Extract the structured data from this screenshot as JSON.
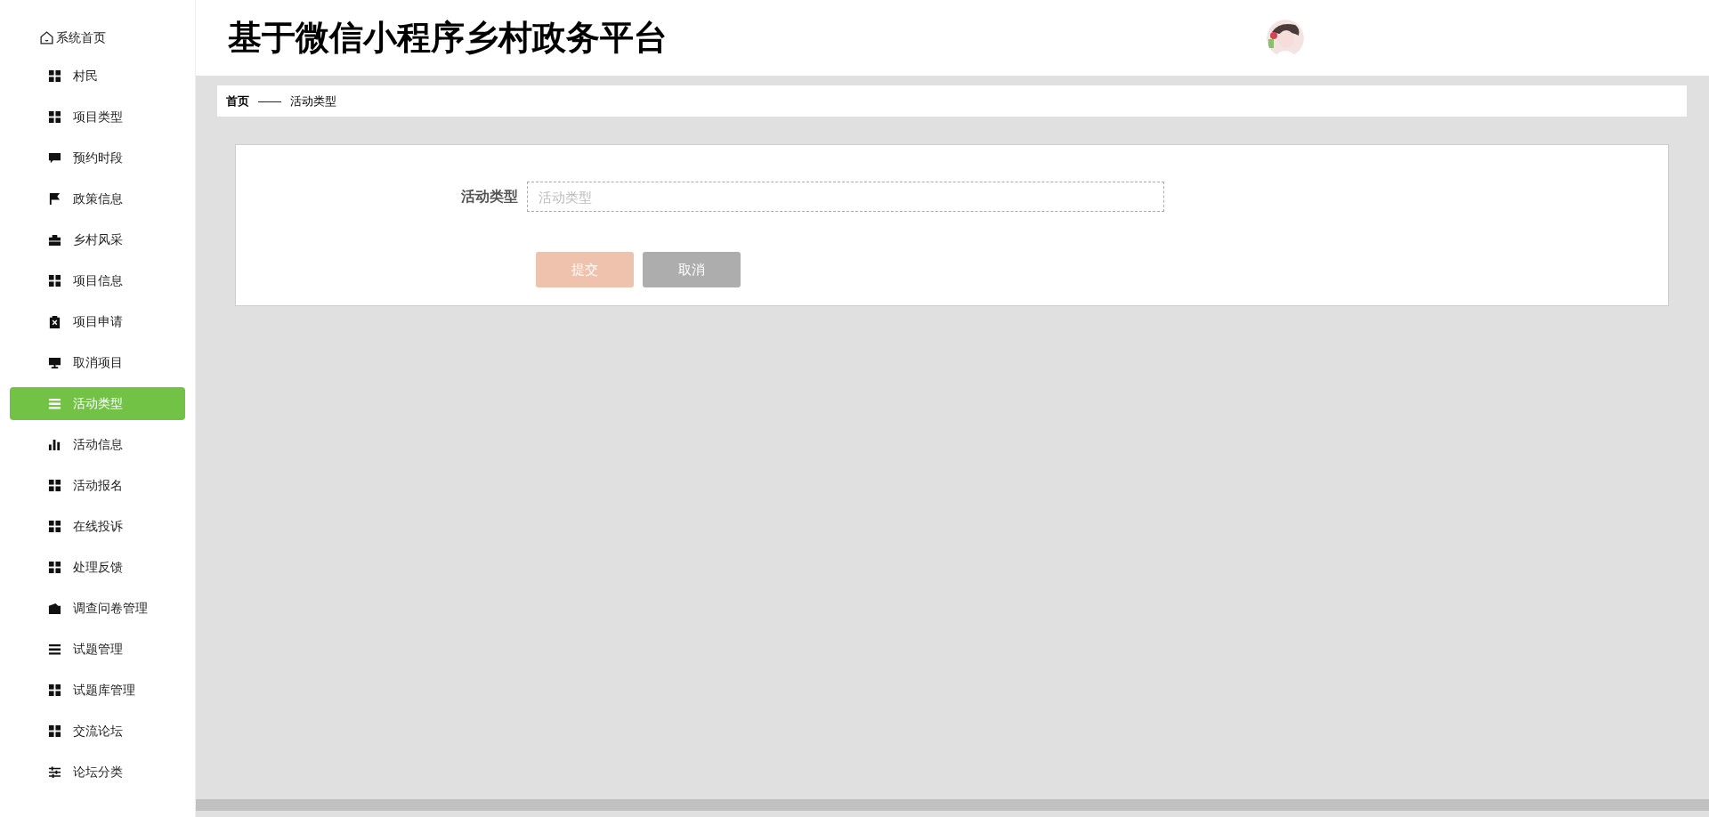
{
  "sidebar": {
    "home": {
      "label": "系统首页"
    },
    "items": [
      {
        "label": "村民",
        "kind": "grid",
        "selected": false
      },
      {
        "label": "项目类型",
        "kind": "grid",
        "selected": false
      },
      {
        "label": "预约时段",
        "kind": "chat",
        "selected": false
      },
      {
        "label": "政策信息",
        "kind": "flag",
        "selected": false
      },
      {
        "label": "乡村风采",
        "kind": "briefcase",
        "selected": false
      },
      {
        "label": "项目信息",
        "kind": "grid",
        "selected": false
      },
      {
        "label": "项目申请",
        "kind": "clipboard",
        "selected": false
      },
      {
        "label": "取消项目",
        "kind": "monitor",
        "selected": false
      },
      {
        "label": "活动类型",
        "kind": "list",
        "selected": true
      },
      {
        "label": "活动信息",
        "kind": "bars",
        "selected": false
      },
      {
        "label": "活动报名",
        "kind": "grid",
        "selected": false
      },
      {
        "label": "在线投诉",
        "kind": "grid",
        "selected": false
      },
      {
        "label": "处理反馈",
        "kind": "grid",
        "selected": false
      },
      {
        "label": "调查问卷管理",
        "kind": "wallet",
        "selected": false
      },
      {
        "label": "试题管理",
        "kind": "list",
        "selected": false
      },
      {
        "label": "试题库管理",
        "kind": "grid",
        "selected": false
      },
      {
        "label": "交流论坛",
        "kind": "grid",
        "selected": false
      },
      {
        "label": "论坛分类",
        "kind": "sliders",
        "selected": false
      }
    ]
  },
  "header": {
    "title": "基于微信小程序乡村政务平台"
  },
  "breadcrumb": {
    "home": "首页",
    "separator": "——",
    "current": "活动类型"
  },
  "form": {
    "fields": [
      {
        "label": "活动类型",
        "placeholder": "活动类型"
      }
    ],
    "buttons": [
      {
        "label": "提交",
        "kind": "primary"
      },
      {
        "label": "取消",
        "kind": "secondary"
      }
    ]
  }
}
